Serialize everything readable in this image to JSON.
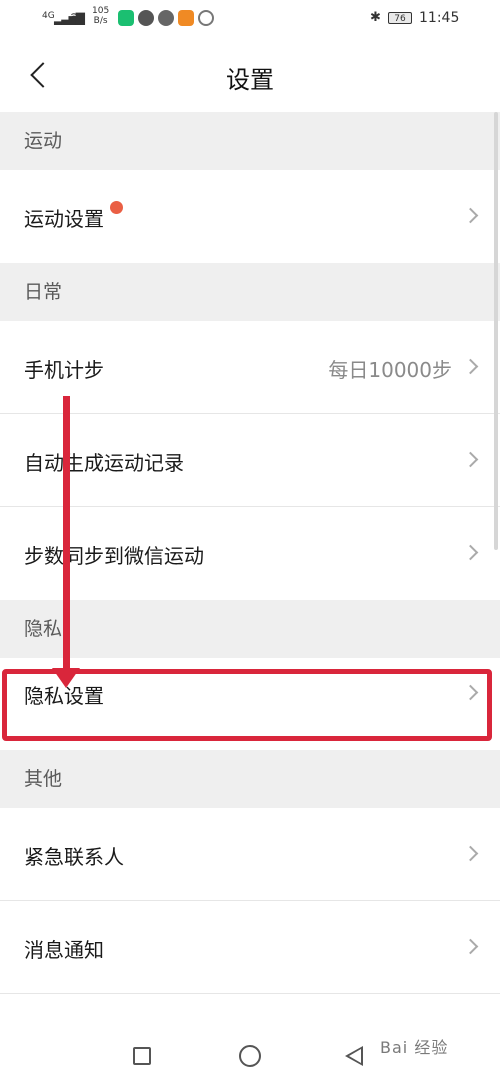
{
  "status_bar": {
    "network": "4G",
    "speed_value": "105",
    "speed_unit": "B/s",
    "battery": "76",
    "time": "11:45"
  },
  "header": {
    "title": "设置"
  },
  "sections": {
    "sport": {
      "title": "运动",
      "items": [
        {
          "label": "运动设置"
        }
      ]
    },
    "daily": {
      "title": "日常",
      "items": [
        {
          "label": "手机计步",
          "value": "每日10000步"
        },
        {
          "label": "自动生成运动记录"
        },
        {
          "label": "步数同步到微信运动"
        }
      ]
    },
    "privacy": {
      "title": "隐私",
      "items": [
        {
          "label": "隐私设置"
        }
      ]
    },
    "other": {
      "title": "其他",
      "items": [
        {
          "label": "紧急联系人"
        },
        {
          "label": "消息通知"
        }
      ]
    }
  },
  "colors": {
    "highlight": "#d9263b",
    "badge": "#ea5f44",
    "section_bg": "#efefef"
  },
  "watermark": "Bai 经验"
}
